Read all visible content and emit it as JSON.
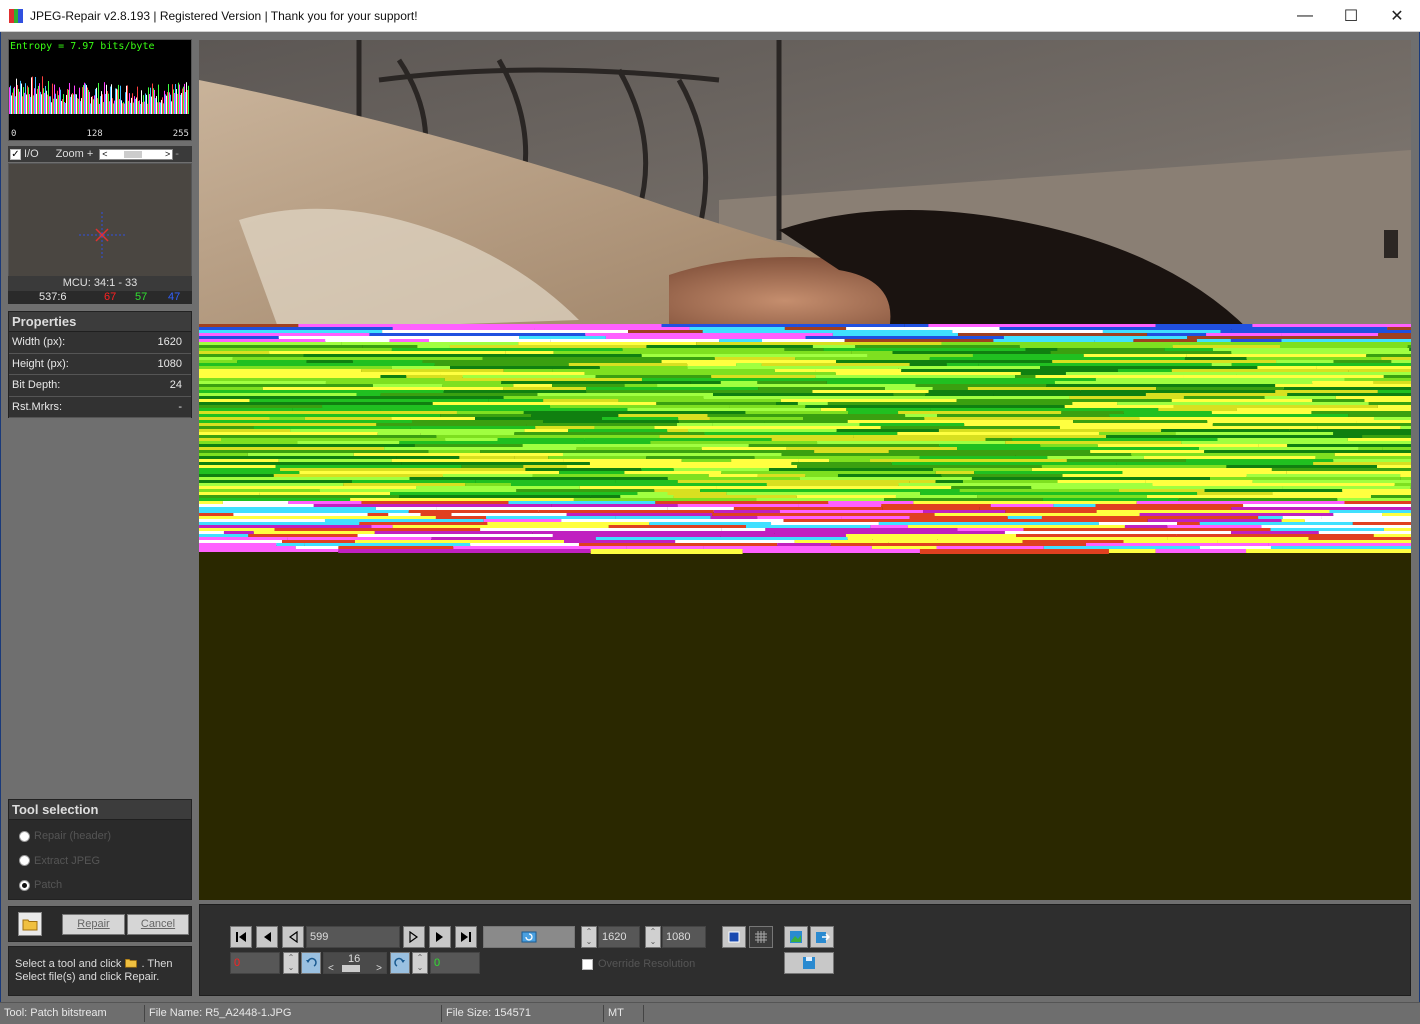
{
  "window": {
    "title": "JPEG-Repair v2.8.193 | Registered Version | Thank you for your support!",
    "minimize": "—",
    "maximize": "☐",
    "close": "✕"
  },
  "entropy": {
    "label": "Entropy = 7.97 bits/byte",
    "ticks": [
      "0",
      "128",
      "255"
    ]
  },
  "zoom_bar": {
    "io_label": "I/O",
    "zoom_label": "Zoom +",
    "io_checked": true
  },
  "mcu": {
    "label": "MCU: 34:1 - 33",
    "position": "537:6",
    "r": "67",
    "g": "57",
    "b": "47"
  },
  "properties": {
    "title": "Properties",
    "rows": [
      {
        "label": "Width (px):",
        "value": "1620"
      },
      {
        "label": "Height (px):",
        "value": "1080"
      },
      {
        "label": "Bit Depth:",
        "value": "24"
      },
      {
        "label": "Rst.Mrkrs:",
        "value": "-"
      }
    ]
  },
  "tools": {
    "title": "Tool selection",
    "options": [
      {
        "label": "Repair (header)",
        "selected": false
      },
      {
        "label": "Extract JPEG",
        "selected": false
      },
      {
        "label": "Patch",
        "selected": true
      }
    ]
  },
  "actions": {
    "repair": "Repair",
    "cancel": "Cancel"
  },
  "hint": {
    "line1a": "Select a tool and click",
    "line1b": ". Then",
    "line2": "Select file(s) and click Repair."
  },
  "controls": {
    "offset": "599",
    "width": "1620",
    "height": "1080",
    "shift": "0",
    "step": "16",
    "delta": "0",
    "override_label": "Override Resolution",
    "override_checked": false
  },
  "status": {
    "tool": "Tool: Patch bitstream",
    "file_name": "File Name: R5_A2448-1.JPG",
    "file_size": "File Size: 154571",
    "mode": "MT"
  },
  "colors": {
    "entropy_text": "#39ff14",
    "r": "#ff2020",
    "g": "#30e030",
    "b": "#3060ff",
    "viewer_bg": "#2a2800"
  }
}
